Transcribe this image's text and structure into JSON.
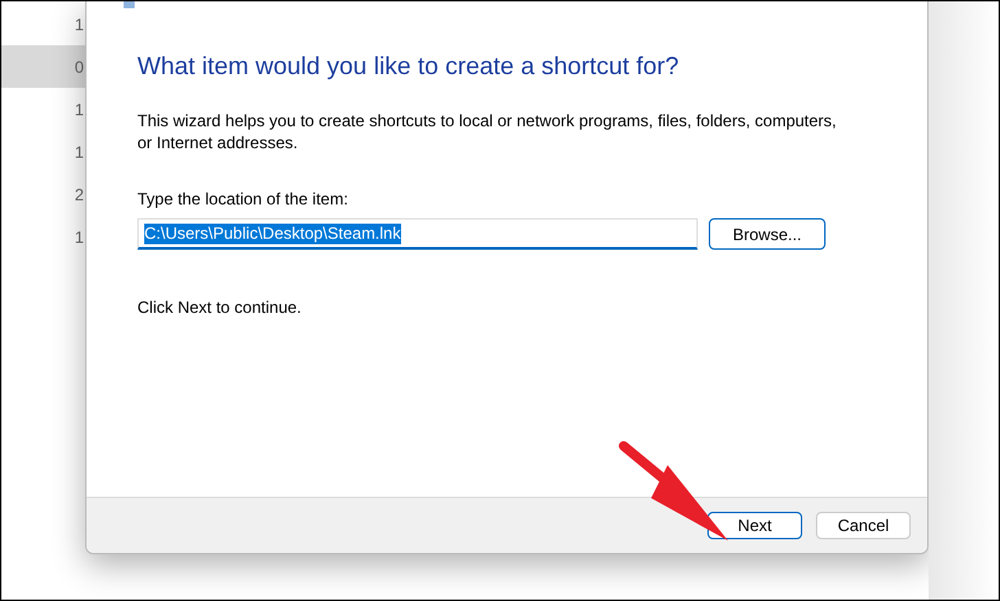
{
  "background_list": [
    {
      "text": "1",
      "selected": false
    },
    {
      "text": "0",
      "selected": true
    },
    {
      "text": "1",
      "selected": false
    },
    {
      "text": "1",
      "selected": false
    },
    {
      "text": "2",
      "selected": false
    },
    {
      "text": "1",
      "selected": false
    }
  ],
  "dialog": {
    "heading": "What item would you like to create a shortcut for?",
    "description": "This wizard helps you to create shortcuts to local or network programs, files, folders, computers, or Internet addresses.",
    "location_label": "Type the location of the item:",
    "location_value": "C:\\Users\\Public\\Desktop\\Steam.lnk",
    "browse_button": "Browse...",
    "hint": "Click Next to continue.",
    "buttons": [
      {
        "label": "Next",
        "selected": true
      },
      {
        "label": "Cancel",
        "selected": false
      }
    ]
  }
}
